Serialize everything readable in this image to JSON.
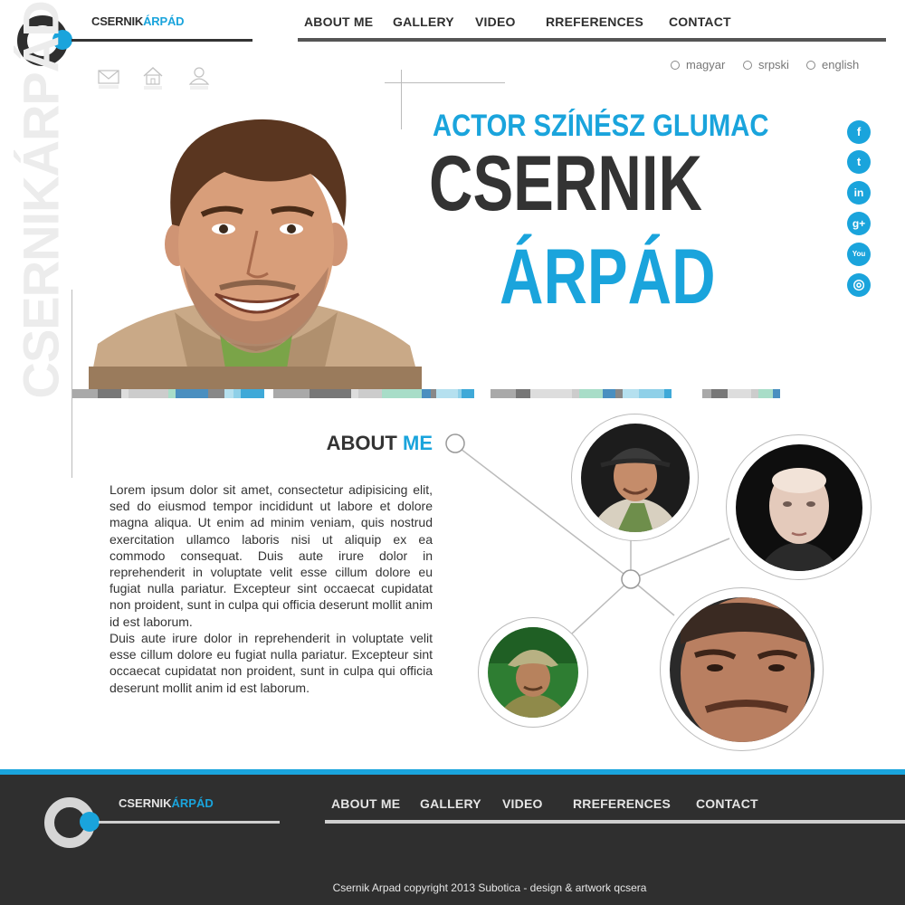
{
  "brand": {
    "name": "CSERNIK",
    "name_accent": "ÁRPÁD",
    "vertical": "CSERNIKÁRPÁD"
  },
  "nav": {
    "about": "ABOUT ME",
    "gallery": "GALLERY",
    "video": "VIDEO",
    "references": "RREFERENCES",
    "contact": "CONTACT"
  },
  "languages": [
    "magyar",
    "srpski",
    "english"
  ],
  "hero": {
    "tagline": "ACTOR SZÍNÉSZ GLUMAC",
    "first_name": "CSERNIK",
    "last_name": "ÁRPÁD"
  },
  "social": {
    "facebook": "f",
    "twitter": "t",
    "linkedin": "in",
    "googleplus": "g+",
    "youtube": "You",
    "instagram": "◎"
  },
  "about": {
    "title": "ABOUT",
    "title_accent": "ME",
    "paragraph1": "Lorem ipsum dolor sit amet, consectetur adipisicing elit, sed do eiusmod tempor incididunt ut labore et dolore magna aliqua. Ut enim ad minim veniam, quis nostrud exercitation ullamco laboris nisi ut aliquip ex ea commodo consequat. Duis aute irure dolor in reprehenderit in voluptate velit esse cillum dolore eu fugiat nulla pariatur. Excepteur sint occaecat cupidatat non proident, sunt in culpa qui officia deserunt mollit anim id est laborum.",
    "paragraph2": "Duis aute irure dolor in reprehenderit in voluptate velit esse cillum dolore eu fugiat nulla pariatur. Excepteur sint occaecat cupidatat non proident, sunt in culpa qui officia deserunt mollit anim id est laborum."
  },
  "footer": {
    "copyright": "Csernik Arpad copyright 2013 Subotica - design & artwork qcsera"
  },
  "colors": {
    "accent": "#1aa4dc",
    "dark": "#2f2f2f",
    "stripe": [
      "#3fa9d8",
      "#888888",
      "#cccccc",
      "#a9a9a9",
      "#8fd0e8",
      "#4a8fc0",
      "#dddddd",
      "#ffffff",
      "#b5e0ef",
      "#a8ddc8",
      "#777777"
    ]
  }
}
